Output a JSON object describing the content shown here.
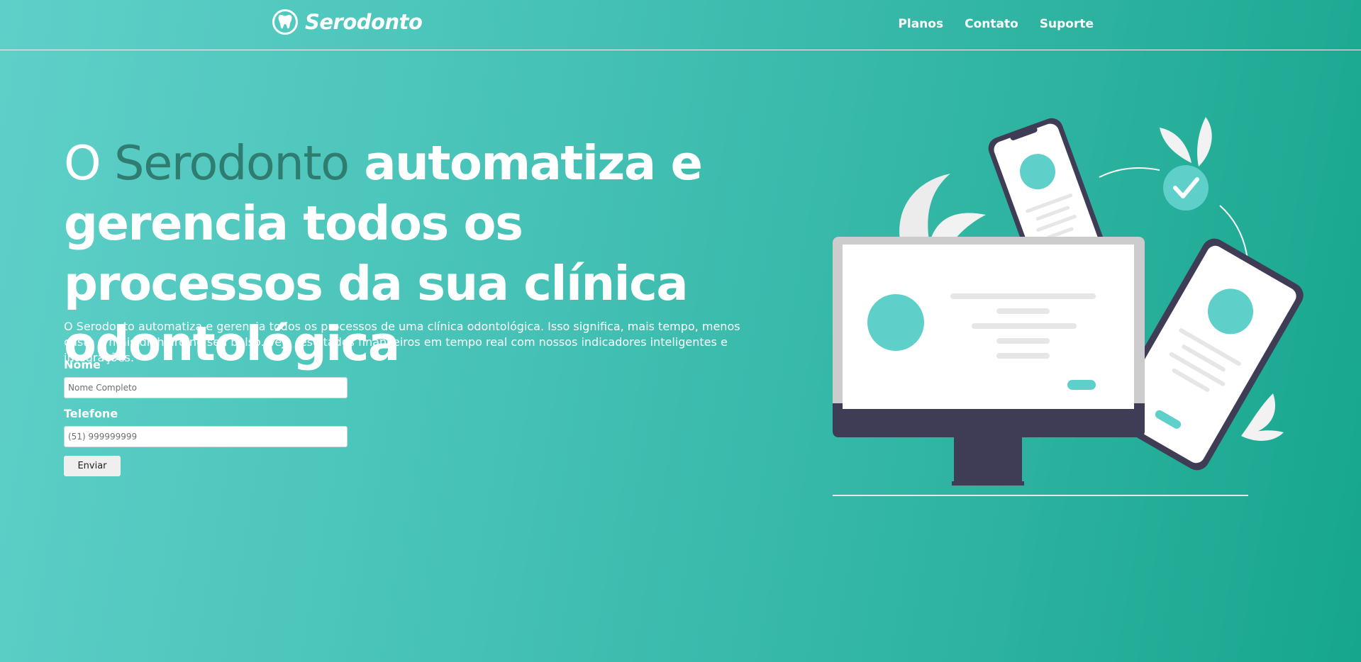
{
  "navbar": {
    "brand_name": "Serodonto",
    "links": [
      {
        "label": "Planos"
      },
      {
        "label": "Contato"
      },
      {
        "label": "Suporte"
      }
    ]
  },
  "hero": {
    "title_prefix": "O ",
    "title_accent": "Serodonto",
    "title_rest": " automatiza e gerencia todos os processos da sua clínica odontológica",
    "description": "O Serodonto automatiza e gerencia todos os processos de uma clínica odontológica. Isso significa, mais tempo, menos custo e mais dinheiro no seu bolso. Veja resultados financeiros em tempo real com nossos indicadores inteligentes e integrações."
  },
  "form": {
    "name_label": "Nome",
    "name_placeholder": "Nome Completo",
    "name_value": "",
    "phone_label": "Telefone",
    "phone_placeholder": "(51) 999999999",
    "phone_value": "",
    "submit_label": "Enviar"
  },
  "colors": {
    "accent_text": "#2f7d70",
    "illustration_teal": "#5ecfc9",
    "device_dark": "#3f3d56"
  },
  "icons": {
    "brand": "tooth-icon",
    "illustration_check": "check-circle-icon"
  }
}
